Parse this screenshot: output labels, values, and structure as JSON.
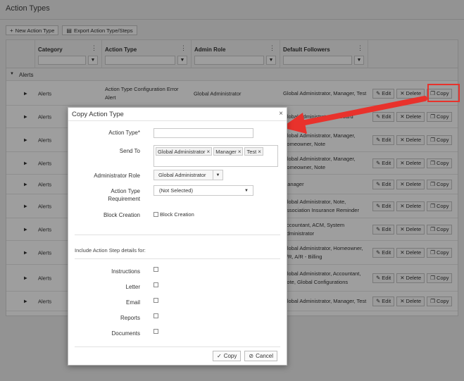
{
  "page": {
    "title": "Action Types"
  },
  "toolbar": {
    "new_label": "New Action Type",
    "export_label": "Export Action Type/Steps"
  },
  "grid": {
    "columns": [
      "Category",
      "Action Type",
      "Admin Role",
      "Default Followers"
    ],
    "group_label": "Alerts",
    "rows": [
      {
        "category": "Alerts",
        "action_type": "Action Type Configuration Error Alert",
        "admin_role": "Global Administrator",
        "followers": "Global Administrator, Manager, Test"
      },
      {
        "category": "Alerts",
        "action_type": "",
        "admin_role": "",
        "followers": "Global Administrator, ... Board"
      },
      {
        "category": "Alerts",
        "action_type": "",
        "admin_role": "",
        "followers": "Global Administrator, Manager, Homeowner, Note"
      },
      {
        "category": "Alerts",
        "action_type": "",
        "admin_role": "",
        "followers": "Global Administrator, Manager, Homeowner, Note"
      },
      {
        "category": "Alerts",
        "action_type": "",
        "admin_role": "",
        "followers": "Manager"
      },
      {
        "category": "Alerts",
        "action_type": "",
        "admin_role": "",
        "followers": "Global Administrator, Note, Association Insurance Reminder"
      },
      {
        "category": "Alerts",
        "action_type": "",
        "admin_role": "",
        "followers": "Accountant, ACM, System Administrator"
      },
      {
        "category": "Alerts",
        "action_type": "",
        "admin_role": "",
        "followers": "Global Administrator, Homeowner, A/R, A/R - Billing"
      },
      {
        "category": "Alerts",
        "action_type": "",
        "admin_role": "",
        "followers": "Global Administrator, Accountant, Note, Global Configurations"
      },
      {
        "category": "Alerts",
        "action_type": "",
        "admin_role": "",
        "followers": "Global Administrator, Manager, Test"
      }
    ],
    "edit_label": "Edit",
    "delete_label": "Delete",
    "copy_label": "Copy"
  },
  "modal": {
    "title": "Copy Action Type",
    "action_type_label": "Action Type*",
    "action_type_value": "",
    "send_to_label": "Send To",
    "send_to_tags": [
      "Global Administrator",
      "Manager",
      "Test"
    ],
    "admin_role_label": "Administrator Role",
    "admin_role_value": "Global Administrator",
    "requirement_label": "Action Type Requirement",
    "requirement_value": "(Not Selected)",
    "block_creation_label": "Block Creation",
    "block_creation_cb_label": "Block Creation",
    "include_label": "Include Action Step details for:",
    "step_items": [
      "Instructions",
      "Letter",
      "Email",
      "Reports",
      "Documents"
    ],
    "copy_button": "Copy",
    "cancel_button": "Cancel"
  },
  "colors": {
    "highlight": "#e8322c",
    "arrow": "#e8322c"
  }
}
